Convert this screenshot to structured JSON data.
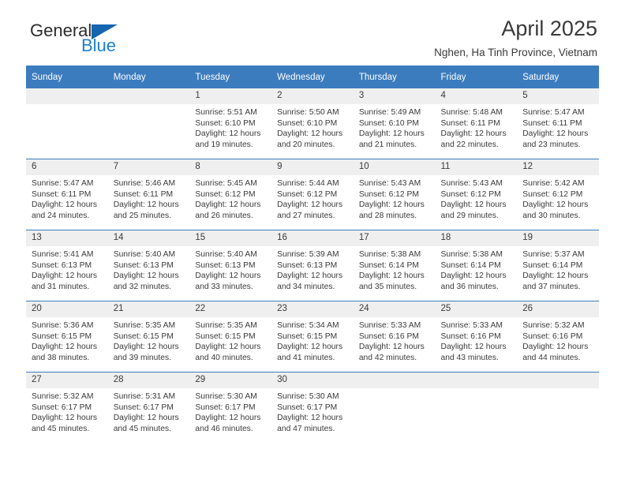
{
  "logo": {
    "name_part1": "General",
    "name_part2": "Blue",
    "triangle_color": "#1565b0",
    "blue_color": "#1f7fd0"
  },
  "header": {
    "title": "April 2025",
    "subtitle": "Nghen, Ha Tinh Province, Vietnam",
    "header_bg": "#3b7cbf"
  },
  "weekday_headers": [
    "Sunday",
    "Monday",
    "Tuesday",
    "Wednesday",
    "Thursday",
    "Friday",
    "Saturday"
  ],
  "labels": {
    "sunrise_prefix": "Sunrise:",
    "sunset_prefix": "Sunset:",
    "daylight_prefix": "Daylight:"
  },
  "weeks": [
    [
      {
        "day": "",
        "sunrise": "",
        "sunset": "",
        "daylight": ""
      },
      {
        "day": "",
        "sunrise": "",
        "sunset": "",
        "daylight": ""
      },
      {
        "day": "1",
        "sunrise": "Sunrise: 5:51 AM",
        "sunset": "Sunset: 6:10 PM",
        "daylight": "Daylight: 12 hours and 19 minutes."
      },
      {
        "day": "2",
        "sunrise": "Sunrise: 5:50 AM",
        "sunset": "Sunset: 6:10 PM",
        "daylight": "Daylight: 12 hours and 20 minutes."
      },
      {
        "day": "3",
        "sunrise": "Sunrise: 5:49 AM",
        "sunset": "Sunset: 6:10 PM",
        "daylight": "Daylight: 12 hours and 21 minutes."
      },
      {
        "day": "4",
        "sunrise": "Sunrise: 5:48 AM",
        "sunset": "Sunset: 6:11 PM",
        "daylight": "Daylight: 12 hours and 22 minutes."
      },
      {
        "day": "5",
        "sunrise": "Sunrise: 5:47 AM",
        "sunset": "Sunset: 6:11 PM",
        "daylight": "Daylight: 12 hours and 23 minutes."
      }
    ],
    [
      {
        "day": "6",
        "sunrise": "Sunrise: 5:47 AM",
        "sunset": "Sunset: 6:11 PM",
        "daylight": "Daylight: 12 hours and 24 minutes."
      },
      {
        "day": "7",
        "sunrise": "Sunrise: 5:46 AM",
        "sunset": "Sunset: 6:11 PM",
        "daylight": "Daylight: 12 hours and 25 minutes."
      },
      {
        "day": "8",
        "sunrise": "Sunrise: 5:45 AM",
        "sunset": "Sunset: 6:12 PM",
        "daylight": "Daylight: 12 hours and 26 minutes."
      },
      {
        "day": "9",
        "sunrise": "Sunrise: 5:44 AM",
        "sunset": "Sunset: 6:12 PM",
        "daylight": "Daylight: 12 hours and 27 minutes."
      },
      {
        "day": "10",
        "sunrise": "Sunrise: 5:43 AM",
        "sunset": "Sunset: 6:12 PM",
        "daylight": "Daylight: 12 hours and 28 minutes."
      },
      {
        "day": "11",
        "sunrise": "Sunrise: 5:43 AM",
        "sunset": "Sunset: 6:12 PM",
        "daylight": "Daylight: 12 hours and 29 minutes."
      },
      {
        "day": "12",
        "sunrise": "Sunrise: 5:42 AM",
        "sunset": "Sunset: 6:12 PM",
        "daylight": "Daylight: 12 hours and 30 minutes."
      }
    ],
    [
      {
        "day": "13",
        "sunrise": "Sunrise: 5:41 AM",
        "sunset": "Sunset: 6:13 PM",
        "daylight": "Daylight: 12 hours and 31 minutes."
      },
      {
        "day": "14",
        "sunrise": "Sunrise: 5:40 AM",
        "sunset": "Sunset: 6:13 PM",
        "daylight": "Daylight: 12 hours and 32 minutes."
      },
      {
        "day": "15",
        "sunrise": "Sunrise: 5:40 AM",
        "sunset": "Sunset: 6:13 PM",
        "daylight": "Daylight: 12 hours and 33 minutes."
      },
      {
        "day": "16",
        "sunrise": "Sunrise: 5:39 AM",
        "sunset": "Sunset: 6:13 PM",
        "daylight": "Daylight: 12 hours and 34 minutes."
      },
      {
        "day": "17",
        "sunrise": "Sunrise: 5:38 AM",
        "sunset": "Sunset: 6:14 PM",
        "daylight": "Daylight: 12 hours and 35 minutes."
      },
      {
        "day": "18",
        "sunrise": "Sunrise: 5:38 AM",
        "sunset": "Sunset: 6:14 PM",
        "daylight": "Daylight: 12 hours and 36 minutes."
      },
      {
        "day": "19",
        "sunrise": "Sunrise: 5:37 AM",
        "sunset": "Sunset: 6:14 PM",
        "daylight": "Daylight: 12 hours and 37 minutes."
      }
    ],
    [
      {
        "day": "20",
        "sunrise": "Sunrise: 5:36 AM",
        "sunset": "Sunset: 6:15 PM",
        "daylight": "Daylight: 12 hours and 38 minutes."
      },
      {
        "day": "21",
        "sunrise": "Sunrise: 5:35 AM",
        "sunset": "Sunset: 6:15 PM",
        "daylight": "Daylight: 12 hours and 39 minutes."
      },
      {
        "day": "22",
        "sunrise": "Sunrise: 5:35 AM",
        "sunset": "Sunset: 6:15 PM",
        "daylight": "Daylight: 12 hours and 40 minutes."
      },
      {
        "day": "23",
        "sunrise": "Sunrise: 5:34 AM",
        "sunset": "Sunset: 6:15 PM",
        "daylight": "Daylight: 12 hours and 41 minutes."
      },
      {
        "day": "24",
        "sunrise": "Sunrise: 5:33 AM",
        "sunset": "Sunset: 6:16 PM",
        "daylight": "Daylight: 12 hours and 42 minutes."
      },
      {
        "day": "25",
        "sunrise": "Sunrise: 5:33 AM",
        "sunset": "Sunset: 6:16 PM",
        "daylight": "Daylight: 12 hours and 43 minutes."
      },
      {
        "day": "26",
        "sunrise": "Sunrise: 5:32 AM",
        "sunset": "Sunset: 6:16 PM",
        "daylight": "Daylight: 12 hours and 44 minutes."
      }
    ],
    [
      {
        "day": "27",
        "sunrise": "Sunrise: 5:32 AM",
        "sunset": "Sunset: 6:17 PM",
        "daylight": "Daylight: 12 hours and 45 minutes."
      },
      {
        "day": "28",
        "sunrise": "Sunrise: 5:31 AM",
        "sunset": "Sunset: 6:17 PM",
        "daylight": "Daylight: 12 hours and 45 minutes."
      },
      {
        "day": "29",
        "sunrise": "Sunrise: 5:30 AM",
        "sunset": "Sunset: 6:17 PM",
        "daylight": "Daylight: 12 hours and 46 minutes."
      },
      {
        "day": "30",
        "sunrise": "Sunrise: 5:30 AM",
        "sunset": "Sunset: 6:17 PM",
        "daylight": "Daylight: 12 hours and 47 minutes."
      },
      {
        "day": "",
        "sunrise": "",
        "sunset": "",
        "daylight": ""
      },
      {
        "day": "",
        "sunrise": "",
        "sunset": "",
        "daylight": ""
      },
      {
        "day": "",
        "sunrise": "",
        "sunset": "",
        "daylight": ""
      }
    ]
  ]
}
